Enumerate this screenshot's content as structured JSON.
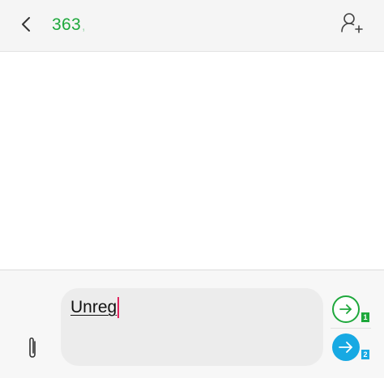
{
  "header": {
    "recipient_number": "363",
    "recipient_separator": ",",
    "back_icon": "chevron-left-icon",
    "add_contact_icon": "add-person-icon"
  },
  "composer": {
    "message_text": "Unreg",
    "attach_icon": "paperclip-icon",
    "send_sim1": {
      "icon": "arrow-right-icon",
      "sim_label": "1",
      "color": "#1ea83c"
    },
    "send_sim2": {
      "icon": "arrow-right-icon",
      "sim_label": "2",
      "color": "#17a9e3"
    }
  },
  "colors": {
    "accent_green": "#1ea83c",
    "accent_blue": "#17a9e3",
    "caret": "#e0245e"
  }
}
